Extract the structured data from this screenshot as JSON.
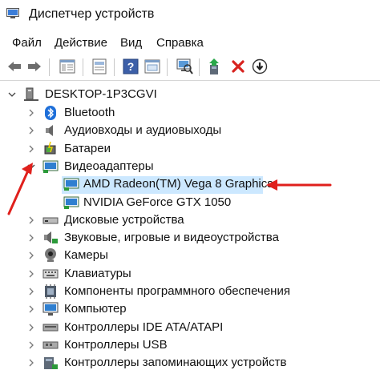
{
  "window": {
    "title": "Диспетчер устройств"
  },
  "menu": [
    "Файл",
    "Действие",
    "Вид",
    "Справка"
  ],
  "toolbar_icons": [
    "back-icon",
    "forward-icon",
    "properties-pane-icon",
    "properties-icon",
    "help-icon",
    "view-icon",
    "scan-hardware-icon",
    "update-driver-icon",
    "uninstall-icon",
    "disable-device-icon"
  ],
  "tree": {
    "root": "DESKTOP-1P3CGVI",
    "categories": [
      {
        "label": "Bluetooth",
        "icon": "bluetooth-icon"
      },
      {
        "label": "Аудиовходы и аудиовыходы",
        "icon": "speaker-icon"
      },
      {
        "label": "Батареи",
        "icon": "battery-icon"
      },
      {
        "label": "Видеоадаптеры",
        "icon": "monitor-icon",
        "expanded": true
      },
      {
        "label": "AMD Radeon(TM) Vega 8 Graphics",
        "icon": "display-adapter-icon",
        "child": true,
        "selected": true
      },
      {
        "label": "NVIDIA GeForce GTX 1050",
        "icon": "display-adapter-icon",
        "child": true
      },
      {
        "label": "Дисковые устройства",
        "icon": "disk-drive-icon"
      },
      {
        "label": "Звуковые, игровые и видеоустройства",
        "icon": "sound-device-icon"
      },
      {
        "label": "Камеры",
        "icon": "camera-icon"
      },
      {
        "label": "Клавиатуры",
        "icon": "keyboard-icon"
      },
      {
        "label": "Компоненты программного обеспечения",
        "icon": "software-component-icon"
      },
      {
        "label": "Компьютер",
        "icon": "computer-icon"
      },
      {
        "label": "Контроллеры IDE ATA/ATAPI",
        "icon": "ide-controller-icon"
      },
      {
        "label": "Контроллеры USB",
        "icon": "usb-controller-icon"
      },
      {
        "label": "Контроллеры запоминающих устройств",
        "icon": "storage-controller-icon"
      }
    ]
  },
  "colors": {
    "selection": "#cce8ff",
    "annotation_arrow": "#e0201c"
  }
}
